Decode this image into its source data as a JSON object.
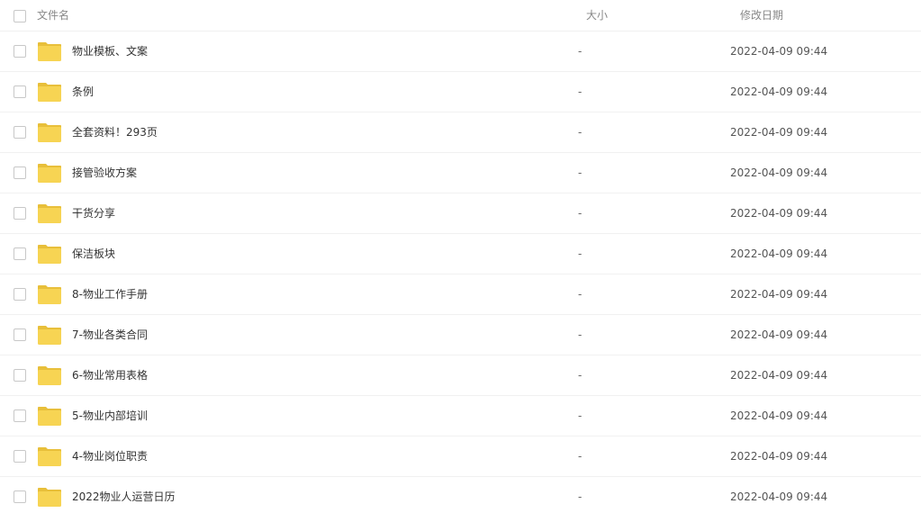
{
  "header": {
    "name_label": "文件名",
    "size_label": "大小",
    "date_label": "修改日期"
  },
  "colors": {
    "folder": "#f7d453",
    "folder_tab": "#e8bf3a",
    "border": "#f0f0f0"
  },
  "rows": [
    {
      "name": "物业模板、文案",
      "size": "-",
      "date": "2022-04-09 09:44",
      "icon": "folder-icon"
    },
    {
      "name": "条例",
      "size": "-",
      "date": "2022-04-09 09:44",
      "icon": "folder-icon"
    },
    {
      "name": "全套资料！293页",
      "size": "-",
      "date": "2022-04-09 09:44",
      "icon": "folder-icon"
    },
    {
      "name": "接管验收方案",
      "size": "-",
      "date": "2022-04-09 09:44",
      "icon": "folder-icon"
    },
    {
      "name": "干货分享",
      "size": "-",
      "date": "2022-04-09 09:44",
      "icon": "folder-icon"
    },
    {
      "name": "保洁板块",
      "size": "-",
      "date": "2022-04-09 09:44",
      "icon": "folder-icon"
    },
    {
      "name": "8-物业工作手册",
      "size": "-",
      "date": "2022-04-09 09:44",
      "icon": "folder-icon"
    },
    {
      "name": "7-物业各类合同",
      "size": "-",
      "date": "2022-04-09 09:44",
      "icon": "folder-icon"
    },
    {
      "name": "6-物业常用表格",
      "size": "-",
      "date": "2022-04-09 09:44",
      "icon": "folder-icon"
    },
    {
      "name": "5-物业内部培训",
      "size": "-",
      "date": "2022-04-09 09:44",
      "icon": "folder-icon"
    },
    {
      "name": "4-物业岗位职责",
      "size": "-",
      "date": "2022-04-09 09:44",
      "icon": "folder-icon"
    },
    {
      "name": "2022物业人运营日历",
      "size": "-",
      "date": "2022-04-09 09:44",
      "icon": "folder-icon"
    }
  ]
}
